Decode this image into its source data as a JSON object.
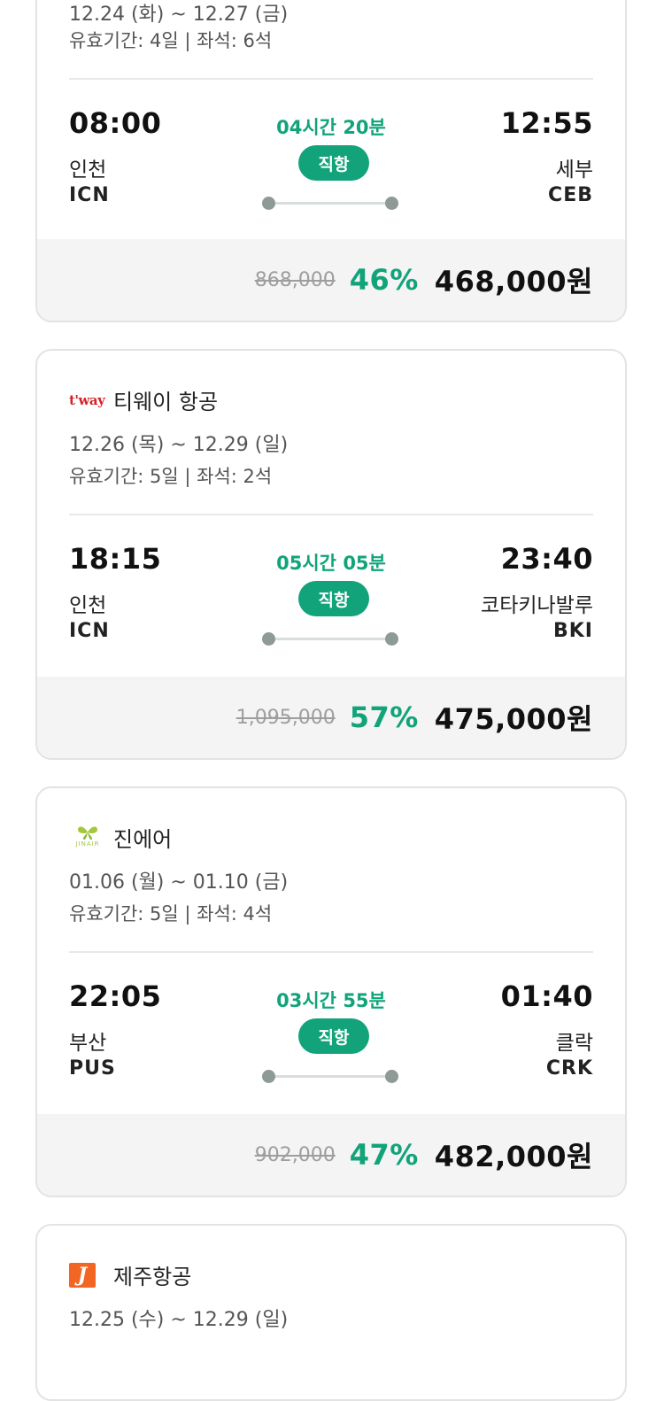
{
  "cards": [
    {
      "airline": "",
      "dates": "12.24 (화) ~ 12.27 (금)",
      "validity": "유효기간: 4일 | 좌석: 6석",
      "depart_time": "08:00",
      "depart_city": "인천",
      "depart_code": "ICN",
      "arrive_time": "12:55",
      "arrive_city": "세부",
      "arrive_code": "CEB",
      "duration": "04시간 20분",
      "flight_type": "직항",
      "original_price": "868,000",
      "discount": "46%",
      "final_price": "468,000원"
    },
    {
      "airline": "티웨이 항공",
      "logo_text": "t'way",
      "dates": "12.26 (목) ~ 12.29 (일)",
      "validity": "유효기간: 5일 | 좌석: 2석",
      "depart_time": "18:15",
      "depart_city": "인천",
      "depart_code": "ICN",
      "arrive_time": "23:40",
      "arrive_city": "코타키나발루",
      "arrive_code": "BKI",
      "duration": "05시간 05분",
      "flight_type": "직항",
      "original_price": "1,095,000",
      "discount": "57%",
      "final_price": "475,000원"
    },
    {
      "airline": "진에어",
      "logo_text": "JINAIR",
      "dates": "01.06 (월) ~ 01.10 (금)",
      "validity": "유효기간: 5일 | 좌석: 4석",
      "depart_time": "22:05",
      "depart_city": "부산",
      "depart_code": "PUS",
      "arrive_time": "01:40",
      "arrive_city": "클락",
      "arrive_code": "CRK",
      "duration": "03시간 55분",
      "flight_type": "직항",
      "original_price": "902,000",
      "discount": "47%",
      "final_price": "482,000원"
    },
    {
      "airline": "제주항공",
      "logo_text": "J",
      "dates": "12.25 (수) ~ 12.29 (일)"
    }
  ],
  "colors": {
    "accent": "#12a37a",
    "tway_red": "#d2232a",
    "jinair_green": "#a3c93a",
    "jeju_orange": "#f26522"
  },
  "icons": {
    "tway": "tway-logo-icon",
    "jinair": "jinair-logo-icon",
    "jeju": "jejuair-logo-icon"
  }
}
